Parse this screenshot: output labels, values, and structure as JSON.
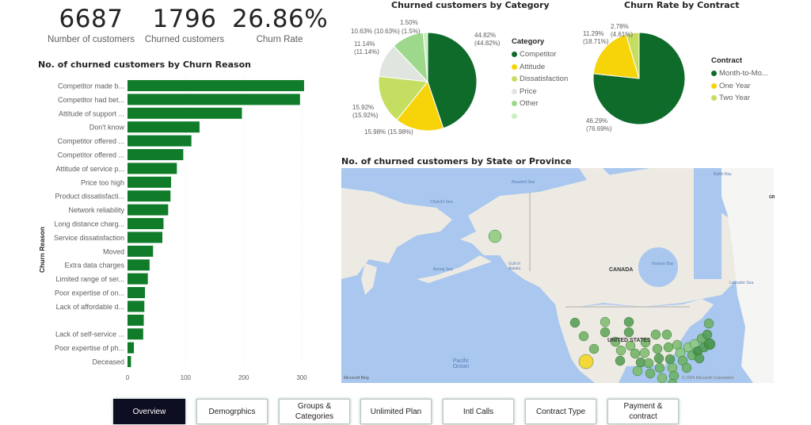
{
  "kpis": [
    {
      "value": "6687",
      "label": "Number of customers"
    },
    {
      "value": "1796",
      "label": "Churned customers"
    },
    {
      "value": "26.86%",
      "label": "Churn Rate"
    }
  ],
  "bar_chart": {
    "title": "No. of churned customers by Churn Reason",
    "ylabel": "Churn Reason"
  },
  "category_pie": {
    "title": "Churned customers by Category",
    "legend_title": "Category",
    "labels": [
      {
        "text1": "44.82%",
        "text2": "(44.82%)"
      },
      {
        "text1": "15.98% (15.98%)",
        "text2": ""
      },
      {
        "text1": "15.92%",
        "text2": "(15.92%)"
      },
      {
        "text1": "11.14%",
        "text2": "(11.14%)"
      },
      {
        "text1": "10.63% (10.63%) (1.5%)",
        "text2": ""
      },
      {
        "text1": "1.50%",
        "text2": ""
      }
    ]
  },
  "contract_pie": {
    "title": "Churn Rate by Contract",
    "legend_title": "Contract",
    "labels": [
      {
        "text1": "46.29%",
        "text2": "(76.69%)"
      },
      {
        "text1": "11.29%",
        "text2": "(18.71%)"
      },
      {
        "text1": "2.78%",
        "text2": "(4.61%)"
      }
    ]
  },
  "map": {
    "title": "No. of churned customers by State or Province",
    "labels": {
      "canada": "CANADA",
      "us": "UNITED STATES",
      "pacific": "Pacific Ocean",
      "beaufort": "Beaufort Sea",
      "chukchi": "Chukchi Sea",
      "bering": "Bering Sea",
      "gulf": "Gulf of Alaska",
      "hudson": "Hudson Bay",
      "baffin": "Baffin Bay",
      "labrador": "Labrador Sea",
      "gr": "GR",
      "attribution": "Microsoft Bing",
      "copyright": "© 2024 Microsoft Corporation"
    }
  },
  "nav": [
    {
      "label": "Overview",
      "active": true
    },
    {
      "label": "Demogrphics",
      "active": false
    },
    {
      "label": "Groups & Categories",
      "active": false
    },
    {
      "label": "Unlimited Plan",
      "active": false
    },
    {
      "label": "Intl Calls",
      "active": false
    },
    {
      "label": "Contract Type",
      "active": false
    },
    {
      "label": "Payment & contract",
      "active": false
    }
  ],
  "colors": {
    "bar": "#107c2a",
    "competitor": "#0f6b2a",
    "attitude": "#f7d40a",
    "dissatisfaction": "#c4de62",
    "price": "#e0e6df",
    "other": "#9ed88c",
    "blank": "#c8f0c0",
    "month": "#0f6b2a",
    "one_year": "#f7d40a",
    "two_year": "#c4de62"
  },
  "chart_data": [
    {
      "type": "bar",
      "orientation": "horizontal",
      "title": "No. of churned customers by Churn Reason",
      "xlabel": "",
      "ylabel": "Churn Reason",
      "xlim": [
        0,
        300
      ],
      "xticks": [
        "0",
        "100",
        "200",
        "300"
      ],
      "categories": [
        "Competitor made b...",
        "Competitor had bet...",
        "Attitude of support ...",
        "Don't know",
        "Competitor offered ...",
        "Competitor offered ...",
        "Attitude of service p...",
        "Price too high",
        "Product dissatisfacti...",
        "Network reliability",
        "Long distance charg...",
        "Service dissatisfaction",
        "Moved",
        "Extra data charges",
        "Limited range of ser...",
        "Poor expertise of on...",
        "Lack of affordable d...",
        "",
        "Lack of self-service ...",
        "Poor expertise of ph...",
        "Deceased"
      ],
      "values": [
        304,
        297,
        197,
        124,
        110,
        96,
        85,
        75,
        74,
        70,
        62,
        60,
        44,
        38,
        35,
        30,
        29,
        28,
        27,
        11,
        6
      ],
      "grid": true
    },
    {
      "type": "pie",
      "title": "Churned customers by Category",
      "legend_title": "Category",
      "legend_position": "right",
      "categories": [
        "Competitor",
        "Attitude",
        "Dissatisfaction",
        "Price",
        "Other",
        ""
      ],
      "values": [
        44.82,
        15.98,
        15.92,
        11.14,
        10.63,
        1.5
      ]
    },
    {
      "type": "pie",
      "title": "Churn Rate by Contract",
      "legend_title": "Contract",
      "legend_position": "right",
      "categories": [
        "Month-to-Mo...",
        "One Year",
        "Two Year"
      ],
      "values": [
        46.29,
        11.29,
        2.78
      ],
      "share_percent": [
        76.69,
        18.71,
        4.61
      ]
    }
  ]
}
